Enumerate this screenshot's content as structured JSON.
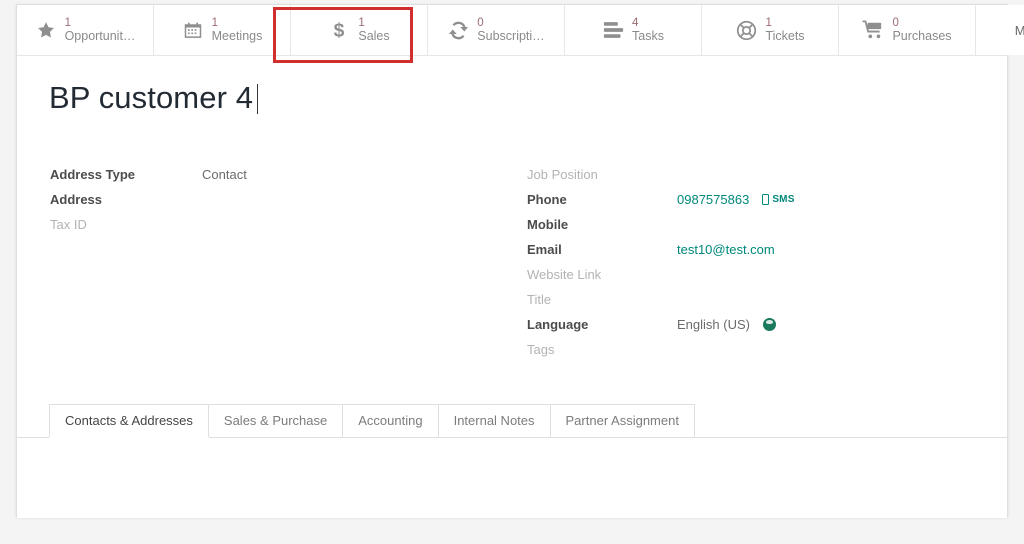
{
  "smart_buttons": [
    {
      "name": "opportunities",
      "icon": "star-icon",
      "value": "1",
      "label": "Opportunit…"
    },
    {
      "name": "meetings",
      "icon": "calendar-icon",
      "value": "1",
      "label": "Meetings"
    },
    {
      "name": "sales",
      "icon": "dollar-icon",
      "value": "1",
      "label": "Sales"
    },
    {
      "name": "subscriptions",
      "icon": "refresh-icon",
      "value": "0",
      "label": "Subscripti…"
    },
    {
      "name": "tasks",
      "icon": "tasks-icon",
      "value": "4",
      "label": "Tasks"
    },
    {
      "name": "tickets",
      "icon": "life-buoy-icon",
      "value": "1",
      "label": "Tickets"
    },
    {
      "name": "purchases",
      "icon": "shopping-cart-icon",
      "value": "0",
      "label": "Purchases"
    }
  ],
  "more_button": {
    "label": "More"
  },
  "highlight": {
    "target": "sales",
    "color": "#d12e2e"
  },
  "record": {
    "title": "BP customer 4"
  },
  "fields_left": [
    {
      "label": "Address Type",
      "value": "Contact",
      "label_empty": false
    },
    {
      "label": "Address",
      "value": "",
      "label_empty": false
    },
    {
      "label": "Tax ID",
      "value": "",
      "label_empty": true
    }
  ],
  "fields_right": [
    {
      "label": "Job Position",
      "value": "",
      "label_empty": true,
      "type": "text"
    },
    {
      "label": "Phone",
      "value": "0987575863",
      "label_empty": false,
      "type": "link",
      "badge": "SMS"
    },
    {
      "label": "Mobile",
      "value": "",
      "label_empty": false,
      "type": "text"
    },
    {
      "label": "Email",
      "value": "test10@test.com",
      "label_empty": false,
      "type": "link"
    },
    {
      "label": "Website Link",
      "value": "",
      "label_empty": true,
      "type": "text"
    },
    {
      "label": "Title",
      "value": "",
      "label_empty": true,
      "type": "text"
    },
    {
      "label": "Language",
      "value": "English (US)",
      "label_empty": false,
      "type": "text",
      "icon": "globe-icon"
    },
    {
      "label": "Tags",
      "value": "",
      "label_empty": true,
      "type": "text"
    }
  ],
  "notebook": {
    "tabs": [
      {
        "label": "Contacts & Addresses",
        "active": true
      },
      {
        "label": "Sales & Purchase",
        "active": false
      },
      {
        "label": "Accounting",
        "active": false
      },
      {
        "label": "Internal Notes",
        "active": false
      },
      {
        "label": "Partner Assignment",
        "active": false
      }
    ]
  },
  "colors": {
    "accent_link": "#00887a",
    "highlight": "#d12e2e",
    "value_badge": "#9b6b72"
  }
}
